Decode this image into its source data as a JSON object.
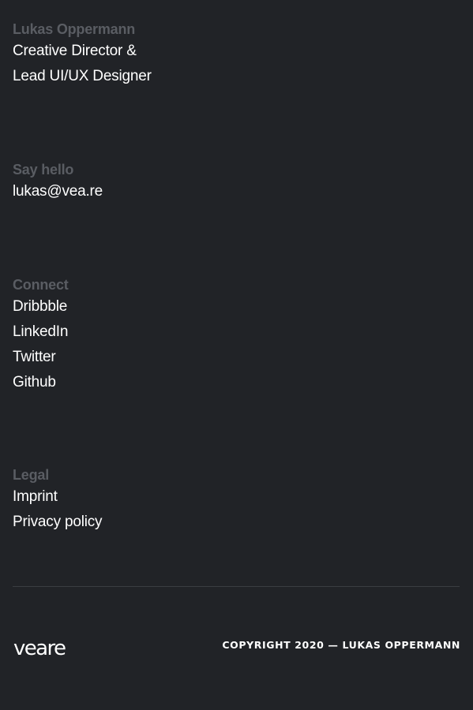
{
  "bio": {
    "name": "Lukas Oppermann",
    "title_line1": "Creative Director &",
    "title_line2": "Lead UI/UX Designer"
  },
  "contact": {
    "heading": "Say hello",
    "email": "lukas@vea.re"
  },
  "connect": {
    "heading": "Connect",
    "links": [
      {
        "label": "Dribbble",
        "icon": "dribbble"
      },
      {
        "label": "LinkedIn",
        "icon": "linkedin"
      },
      {
        "label": "Twitter",
        "icon": "twitter"
      },
      {
        "label": "Github",
        "icon": "github"
      }
    ]
  },
  "legal": {
    "heading": "Legal",
    "links": [
      {
        "label": "Imprint"
      },
      {
        "label": "Privacy policy"
      }
    ]
  },
  "footer": {
    "logo_text": "veare",
    "copyright": "COPYRIGHT 2020 — LUKAS OPPERMANN"
  },
  "colors": {
    "background": "#212327",
    "heading": "#5a5d63",
    "text": "#ffffff",
    "divider": "#3a3d42"
  }
}
